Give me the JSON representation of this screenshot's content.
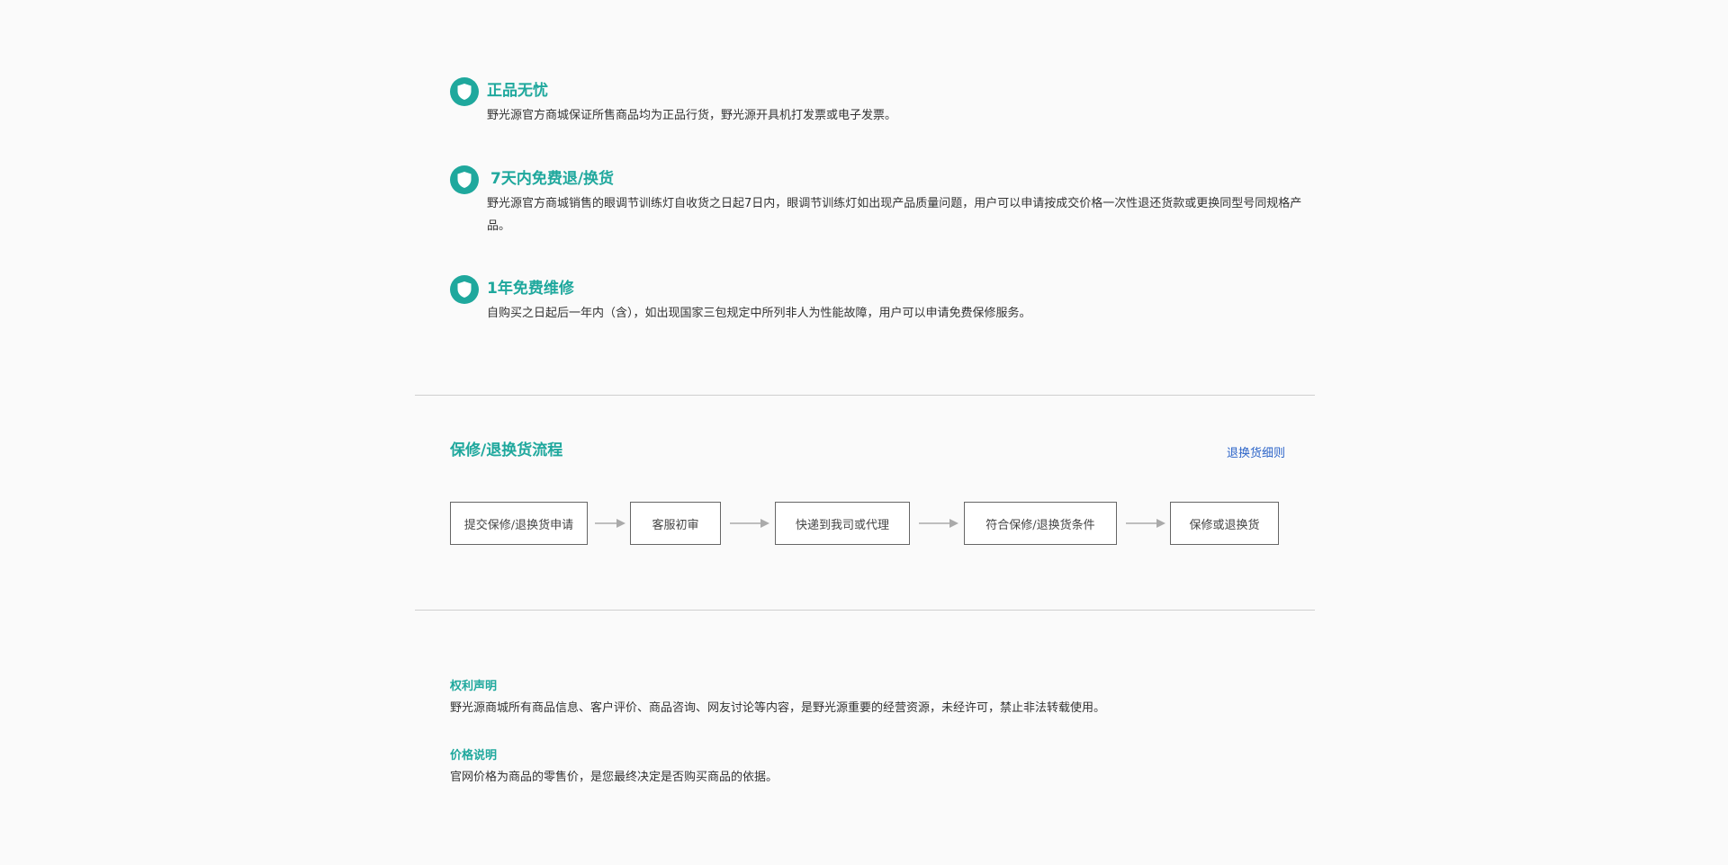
{
  "guarantees": [
    {
      "title": "正品无忧",
      "description": "野光源官方商城保证所售商品均为正品行货，野光源开具机打发票或电子发票。",
      "icon": "shield-icon"
    },
    {
      "title": "7天内免费退/换货",
      "description": "野光源官方商城销售的眼调节训练灯自收货之日起7日内，眼调节训练灯如出现产品质量问题，用户可以申请按成交价格一次性退还货款或更换同型号同规格产品。",
      "icon": "shield-icon"
    },
    {
      "title": "1年免费维修",
      "description": "自购买之日起后一年内（含），如出现国家三包规定中所列非人为性能故障，用户可以申请免费保修服务。",
      "icon": "shield-icon"
    }
  ],
  "process": {
    "title": "保修/退换货流程",
    "rules_link": "退换货细则",
    "steps": [
      "提交保修/退换货申请",
      "客服初审",
      "快递到我司或代理",
      "符合保修/退换货条件",
      "保修或退换货"
    ]
  },
  "notices": [
    {
      "title": "权利声明",
      "description": "野光源商城所有商品信息、客户评价、商品咨询、网友讨论等内容，是野光源重要的经营资源，未经许可，禁止非法转载使用。"
    },
    {
      "title": "价格说明",
      "description": "官网价格为商品的零售价，是您最终决定是否购买商品的依据。"
    }
  ],
  "colors": {
    "accent": "#1fa89d",
    "link": "#2c64c8",
    "text": "#333333",
    "background": "#fafafa"
  }
}
